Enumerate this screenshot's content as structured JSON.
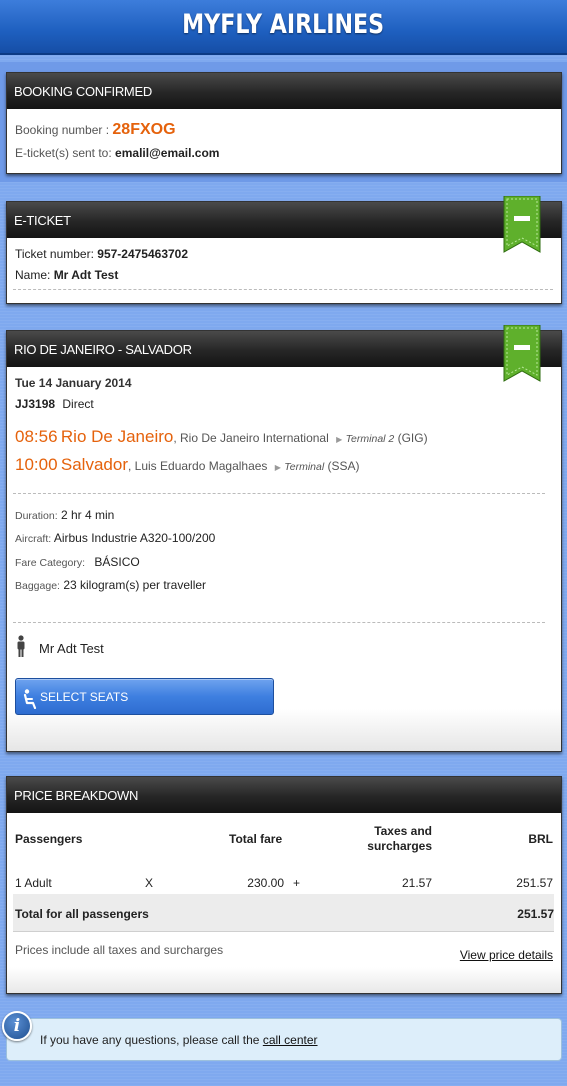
{
  "header": {
    "title": "MYFLY AIRLINES"
  },
  "booking": {
    "title": "BOOKING CONFIRMED",
    "number_label": "Booking number :",
    "number": "28FXOG",
    "eticket_label": "E-ticket(s) sent to:",
    "email": "emalil@email.com"
  },
  "eticket": {
    "title": "E-TICKET",
    "ticket_label": "Ticket number:",
    "ticket_number": "957-2475463702",
    "name_label": "Name:",
    "name": "Mr Adt Test"
  },
  "flight": {
    "title": "RIO DE JANEIRO - SALVADOR",
    "date": "Tue 14 January 2014",
    "flight_no": "JJ3198",
    "type": "Direct",
    "dep_time": "08:56",
    "dep_city": "Rio De Janeiro",
    "dep_airport": ", Rio De Janeiro International",
    "dep_terminal_label": "Terminal 2",
    "dep_code": "(GIG)",
    "arr_time": "10:00",
    "arr_city": "Salvador",
    "arr_airport": ", Luis Eduardo Magalhaes",
    "arr_terminal_label": "Terminal",
    "arr_code": "(SSA)",
    "duration_label": "Duration:",
    "duration": "2 hr 4 min",
    "aircraft_label": "Aircraft:",
    "aircraft": "Airbus Industrie A320-100/200",
    "fare_label": "Fare Category:",
    "fare": "BÁSICO",
    "baggage_label": "Baggage:",
    "baggage": "23 kilogram(s) per traveller",
    "passenger": "Mr Adt Test",
    "select_seats": "SELECT SEATS"
  },
  "price": {
    "title": "PRICE BREAKDOWN",
    "col_passengers": "Passengers",
    "col_total_fare": "Total fare",
    "col_taxes_1": "Taxes and",
    "col_taxes_2": "surcharges",
    "col_currency": "BRL",
    "row_pax": "1 Adult",
    "row_x": "X",
    "row_fare": "230.00",
    "row_plus": "+",
    "row_taxes": "21.57",
    "row_total": "251.57",
    "total_label": "Total for all passengers",
    "total_value": "251.57",
    "note": "Prices include all taxes and surcharges",
    "details_link": "View price details"
  },
  "footer": {
    "info_icon": "i",
    "text": "If you have any questions, please call the",
    "link": "call center"
  },
  "colors": {
    "accent": "#e5620c",
    "header_blue": "#1e5fbf",
    "ribbon_green": "#5fb02c"
  }
}
